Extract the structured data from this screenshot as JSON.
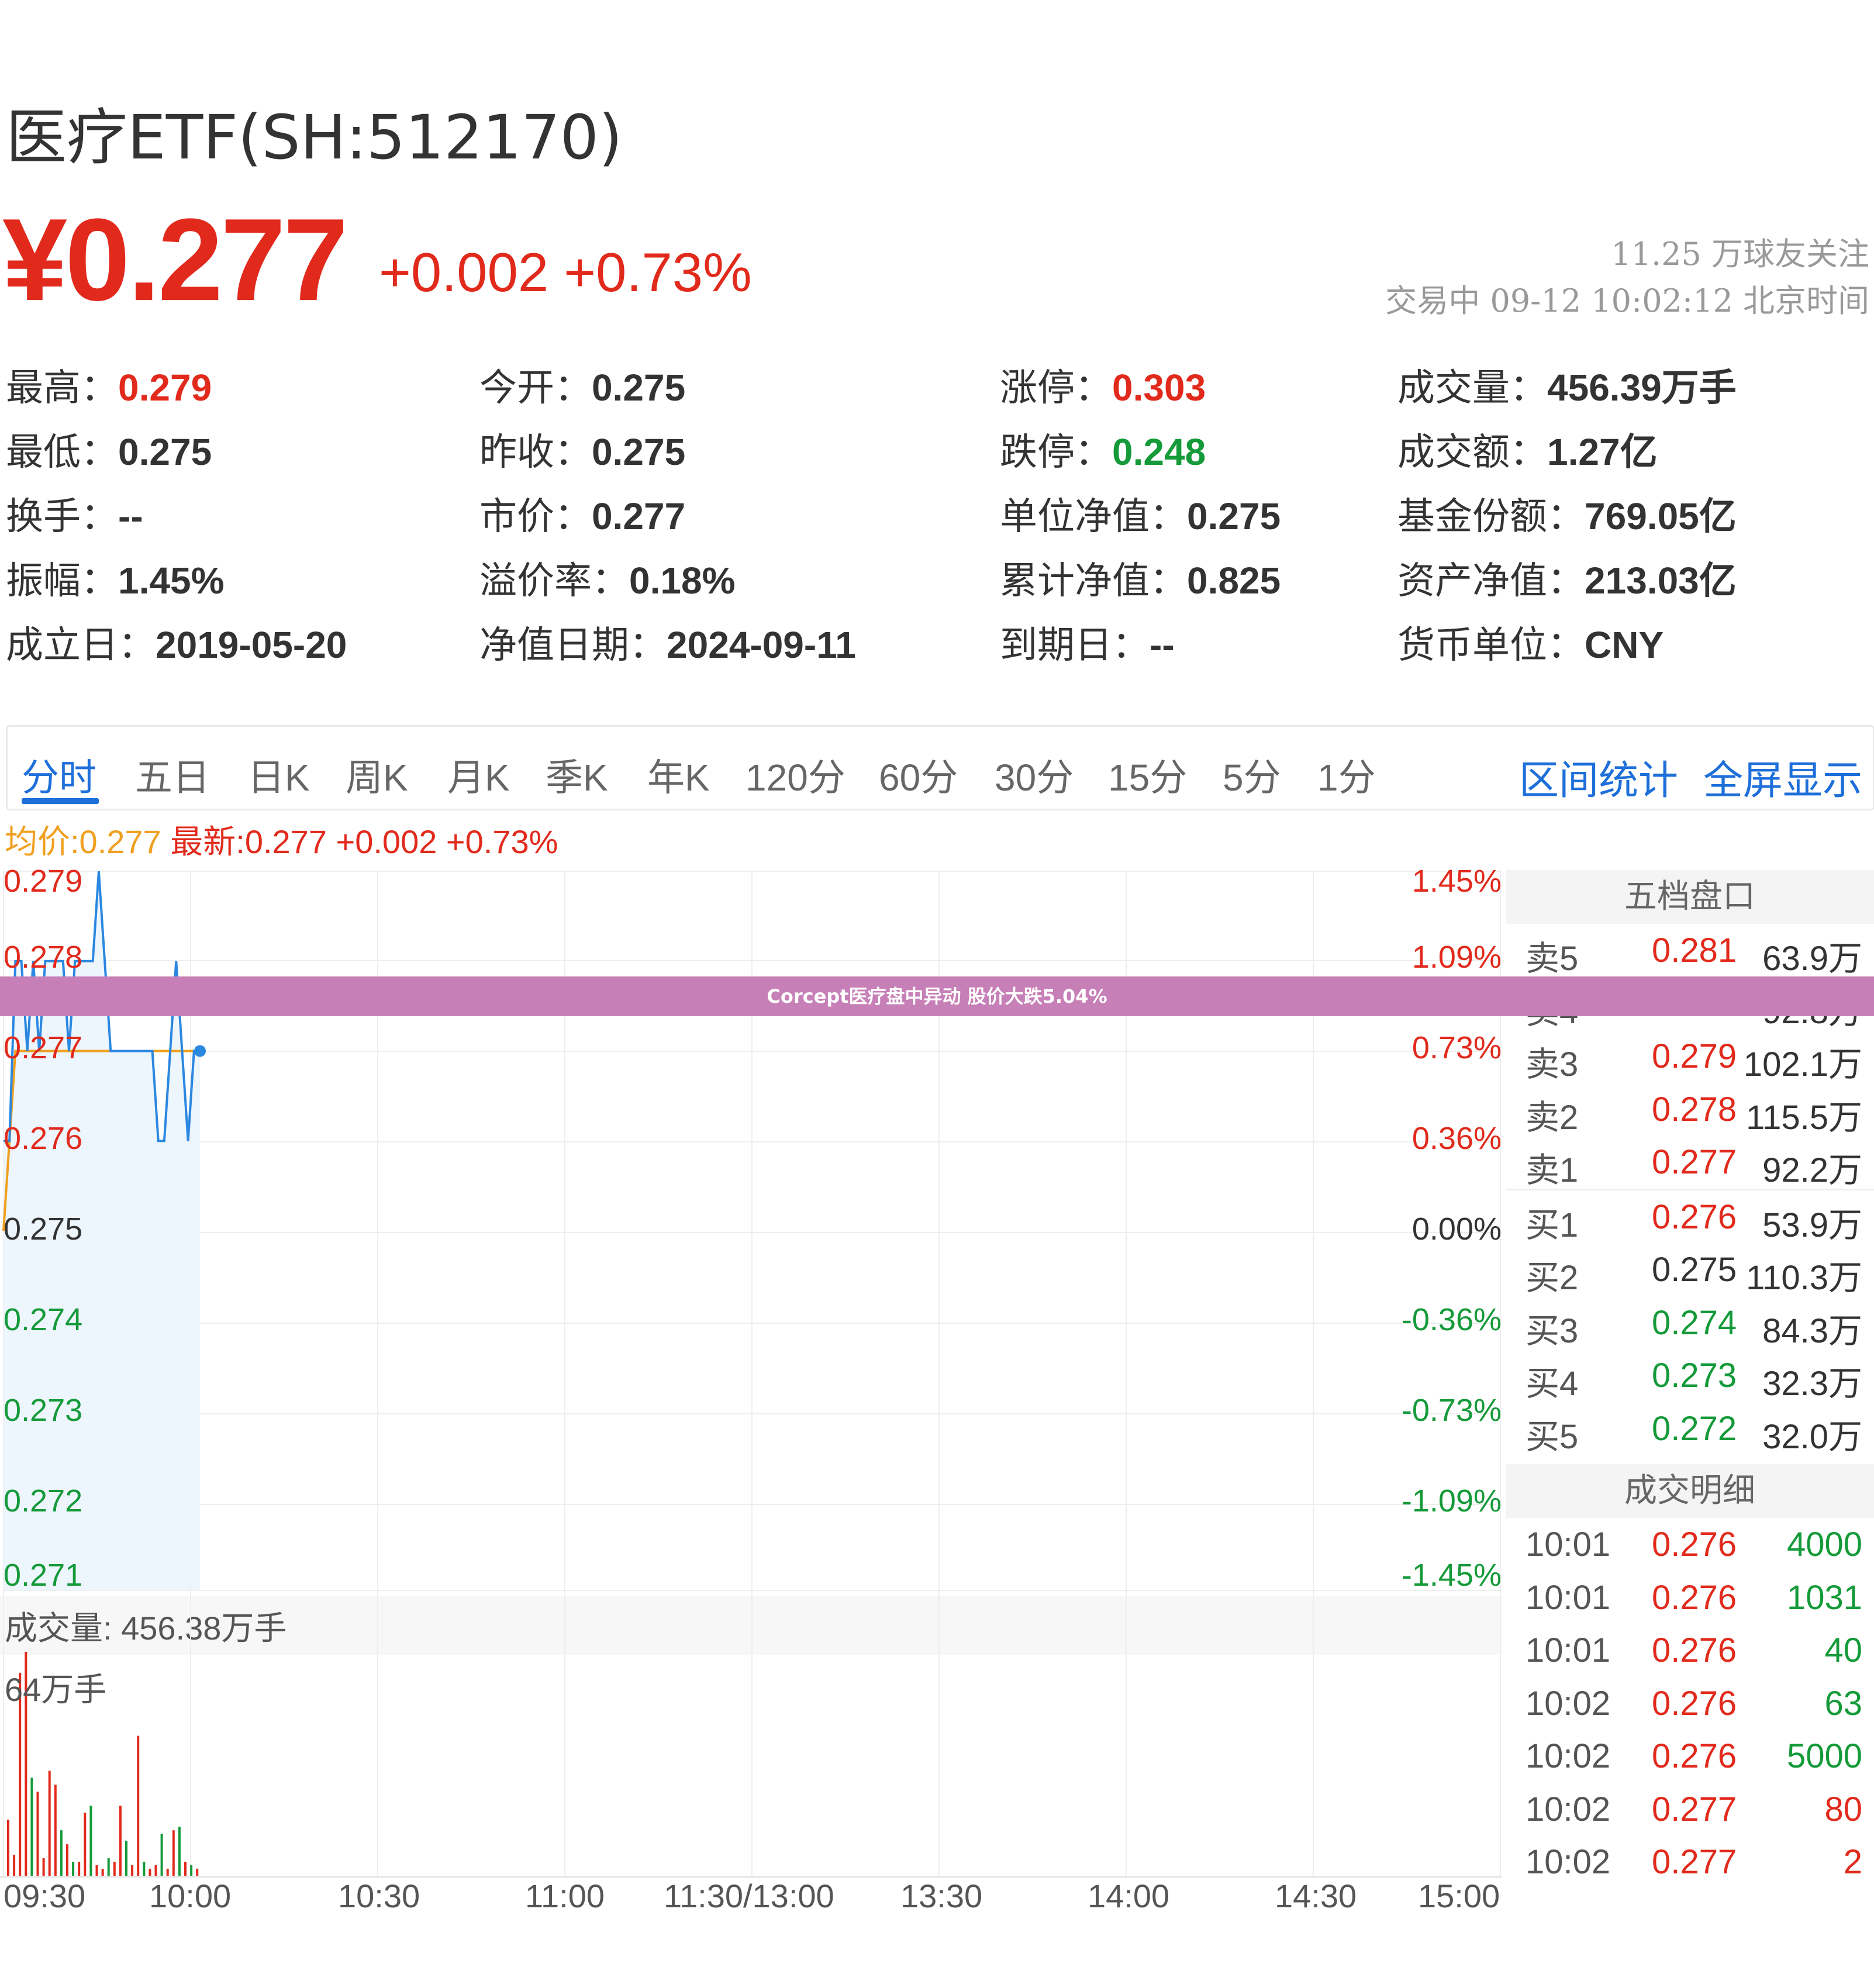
{
  "header": {
    "title": "医疗ETF(SH:512170)",
    "price": "¥0.277",
    "change": "+0.002 +0.73%",
    "followers": "11.25 万球友关注",
    "status": "交易中 09-12 10:02:12 北京时间"
  },
  "stats": {
    "col1": [
      {
        "label": "最高：",
        "value": "0.279",
        "color": "red"
      },
      {
        "label": "最低：",
        "value": "0.275",
        "color": ""
      },
      {
        "label": "换手：",
        "value": "--",
        "color": ""
      },
      {
        "label": "振幅：",
        "value": "1.45%",
        "color": ""
      },
      {
        "label": "成立日：",
        "value": "2019-05-20",
        "color": ""
      }
    ],
    "col2": [
      {
        "label": "今开：",
        "value": "0.275",
        "color": ""
      },
      {
        "label": "昨收：",
        "value": "0.275",
        "color": ""
      },
      {
        "label": "市价：",
        "value": "0.277",
        "color": ""
      },
      {
        "label": "溢价率：",
        "value": "0.18%",
        "color": ""
      },
      {
        "label": "净值日期：",
        "value": "2024-09-11",
        "color": ""
      }
    ],
    "col3": [
      {
        "label": "涨停：",
        "value": "0.303",
        "color": "red"
      },
      {
        "label": "跌停：",
        "value": "0.248",
        "color": "green"
      },
      {
        "label": "单位净值：",
        "value": "0.275",
        "color": ""
      },
      {
        "label": "累计净值：",
        "value": "0.825",
        "color": ""
      },
      {
        "label": "到期日：",
        "value": "--",
        "color": ""
      }
    ],
    "col4": [
      {
        "label": "成交量：",
        "value": "456.39万手",
        "color": ""
      },
      {
        "label": "成交额：",
        "value": "1.27亿",
        "color": ""
      },
      {
        "label": "基金份额：",
        "value": "769.05亿",
        "color": ""
      },
      {
        "label": "资产净值：",
        "value": "213.03亿",
        "color": ""
      },
      {
        "label": "货币单位：",
        "value": "CNY",
        "color": ""
      }
    ]
  },
  "tabs": [
    "分时",
    "五日",
    "日K",
    "周K",
    "月K",
    "季K",
    "年K",
    "120分",
    "60分",
    "30分",
    "15分",
    "5分",
    "1分"
  ],
  "tabs_right": [
    "区间统计",
    "全屏显示"
  ],
  "legend": {
    "avg": "均价:0.277",
    "last": "最新:0.277 +0.002 +0.73%"
  },
  "banner": "Corcept医疗盘中异动 股价大跌5.04%",
  "colors": {
    "up": "#e12a1c",
    "down": "#159a3a",
    "accent": "#1e6fd9",
    "avg_line": "#f0a020",
    "banner": "#c77fb7"
  },
  "order_book": {
    "title": "五档盘口",
    "sell": [
      {
        "label": "卖5",
        "price": "0.281",
        "vol": "63.9万",
        "color": "red"
      },
      {
        "label": "卖4",
        "price": "0.280",
        "vol": "92.8万",
        "color": "red"
      },
      {
        "label": "卖3",
        "price": "0.279",
        "vol": "102.1万",
        "color": "red"
      },
      {
        "label": "卖2",
        "price": "0.278",
        "vol": "115.5万",
        "color": "red"
      },
      {
        "label": "卖1",
        "price": "0.277",
        "vol": "92.2万",
        "color": "red"
      }
    ],
    "buy": [
      {
        "label": "买1",
        "price": "0.276",
        "vol": "53.9万",
        "color": "red"
      },
      {
        "label": "买2",
        "price": "0.275",
        "vol": "110.3万",
        "color": "black"
      },
      {
        "label": "买3",
        "price": "0.274",
        "vol": "84.3万",
        "color": "green"
      },
      {
        "label": "买4",
        "price": "0.273",
        "vol": "32.3万",
        "color": "green"
      },
      {
        "label": "买5",
        "price": "0.272",
        "vol": "32.0万",
        "color": "green"
      }
    ]
  },
  "trades": {
    "title": "成交明细",
    "rows": [
      {
        "time": "10:01",
        "price": "0.276",
        "vol": "4000"
      },
      {
        "time": "10:01",
        "price": "0.276",
        "vol": "1031"
      },
      {
        "time": "10:01",
        "price": "0.276",
        "vol": "40"
      },
      {
        "time": "10:02",
        "price": "0.276",
        "vol": "63"
      },
      {
        "time": "10:02",
        "price": "0.276",
        "vol": "5000"
      },
      {
        "time": "10:02",
        "price": "0.277",
        "vol": "80"
      },
      {
        "time": "10:02",
        "price": "0.277",
        "vol": "2"
      }
    ]
  },
  "volume": {
    "label": "成交量: 456.38万手",
    "max_label": "64万手"
  },
  "chart_data": {
    "type": "line",
    "y_left_ticks": [
      "0.279",
      "0.278",
      "0.277",
      "0.276",
      "0.275",
      "0.274",
      "0.273",
      "0.272",
      "0.271"
    ],
    "y_right_ticks": [
      "1.45%",
      "1.09%",
      "0.73%",
      "0.36%",
      "0.00%",
      "-0.36%",
      "-0.73%",
      "-1.09%",
      "-1.45%"
    ],
    "ylim": [
      0.271,
      0.279
    ],
    "x_ticks": [
      "09:30",
      "10:00",
      "10:30",
      "11:00",
      "11:30/13:00",
      "13:30",
      "14:00",
      "14:30",
      "15:00"
    ],
    "series": [
      {
        "name": "最新",
        "values": [
          0.276,
          0.276,
          0.278,
          0.278,
          0.277,
          0.278,
          0.277,
          0.278,
          0.278,
          0.278,
          0.278,
          0.277,
          0.278,
          0.278,
          0.278,
          0.278,
          0.279,
          0.278,
          0.277,
          0.277,
          0.277,
          0.277,
          0.277,
          0.277,
          0.277,
          0.277,
          0.276,
          0.276,
          0.277,
          0.278,
          0.277,
          0.276,
          0.277,
          0.277
        ]
      },
      {
        "name": "均价",
        "values": [
          0.275,
          0.276,
          0.277,
          0.277,
          0.277,
          0.277,
          0.277,
          0.277,
          0.277,
          0.277,
          0.277,
          0.277,
          0.277,
          0.277,
          0.277,
          0.277,
          0.277,
          0.277,
          0.277,
          0.277,
          0.277,
          0.277,
          0.277,
          0.277,
          0.277,
          0.277,
          0.277,
          0.277,
          0.277,
          0.277,
          0.277,
          0.277,
          0.277,
          0.277
        ]
      }
    ],
    "volume_max": 64,
    "volume": [
      {
        "v": 16,
        "c": "red"
      },
      {
        "v": 6,
        "c": "red"
      },
      {
        "v": 58,
        "c": "red"
      },
      {
        "v": 64,
        "c": "red"
      },
      {
        "v": 28,
        "c": "green"
      },
      {
        "v": 24,
        "c": "red"
      },
      {
        "v": 5,
        "c": "red"
      },
      {
        "v": 30,
        "c": "red"
      },
      {
        "v": 26,
        "c": "red"
      },
      {
        "v": 13,
        "c": "green"
      },
      {
        "v": 9,
        "c": "red"
      },
      {
        "v": 4,
        "c": "green"
      },
      {
        "v": 4,
        "c": "red"
      },
      {
        "v": 18,
        "c": "red"
      },
      {
        "v": 20,
        "c": "green"
      },
      {
        "v": 3,
        "c": "red"
      },
      {
        "v": 2,
        "c": "red"
      },
      {
        "v": 5,
        "c": "green"
      },
      {
        "v": 4,
        "c": "red"
      },
      {
        "v": 20,
        "c": "red"
      },
      {
        "v": 10,
        "c": "green"
      },
      {
        "v": 3,
        "c": "red"
      },
      {
        "v": 40,
        "c": "red"
      },
      {
        "v": 4,
        "c": "green"
      },
      {
        "v": 2,
        "c": "red"
      },
      {
        "v": 3,
        "c": "red"
      },
      {
        "v": 12,
        "c": "green"
      },
      {
        "v": 2,
        "c": "red"
      },
      {
        "v": 13,
        "c": "red"
      },
      {
        "v": 14,
        "c": "green"
      },
      {
        "v": 4,
        "c": "red"
      },
      {
        "v": 3,
        "c": "green"
      },
      {
        "v": 2,
        "c": "red"
      }
    ]
  }
}
